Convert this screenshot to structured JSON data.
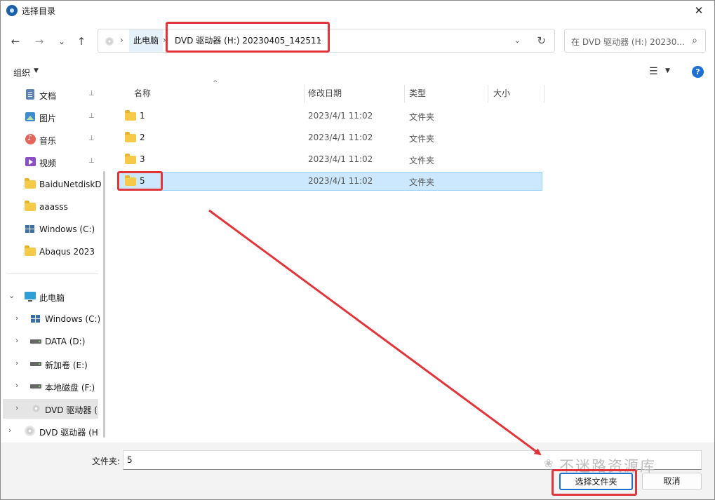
{
  "window": {
    "title": "选择目录",
    "close_glyph": "✕"
  },
  "nav": {
    "back": "←",
    "forward": "→",
    "recent": "⌄",
    "up": "↑"
  },
  "address": {
    "sep1": "›",
    "pc_label": "此电脑",
    "sep2": "›",
    "dvd_label": "DVD 驱动器 (H:) 20230405_142511",
    "sep3": "›",
    "dropdown": "⌄",
    "refresh": "↻"
  },
  "search": {
    "placeholder": "在 DVD 驱动器 (H:) 20230...",
    "icon": "⌕"
  },
  "toolbar": {
    "organize_label": "组织",
    "organize_caret": "▼",
    "view_icon": "☰",
    "view_caret": "▼",
    "help_label": "?"
  },
  "sidebar": {
    "quick_access": [
      {
        "label": "文档",
        "icon": "document-icon",
        "pinned": true
      },
      {
        "label": "图片",
        "icon": "pictures-icon",
        "pinned": true
      },
      {
        "label": "音乐",
        "icon": "music-icon",
        "pinned": true
      },
      {
        "label": "视频",
        "icon": "video-icon",
        "pinned": true
      },
      {
        "label": "BaiduNetdiskD",
        "icon": "folder-icon",
        "pinned": false
      },
      {
        "label": "aaasss",
        "icon": "folder-icon",
        "pinned": false
      },
      {
        "label": "Windows (C:)",
        "icon": "windows-drive-icon",
        "pinned": false
      },
      {
        "label": "Abaqus 2023",
        "icon": "folder-icon",
        "pinned": false
      }
    ],
    "pin_glyph": "📌",
    "this_pc": {
      "label": "此电脑",
      "icon": "computer-icon",
      "expanded_glyph": "⌄"
    },
    "drives": [
      {
        "label": "Windows (C:)",
        "icon": "windows-drive-icon"
      },
      {
        "label": "DATA (D:)",
        "icon": "drive-icon"
      },
      {
        "label": "新加卷 (E:)",
        "icon": "drive-icon"
      },
      {
        "label": "本地磁盘 (F:)",
        "icon": "drive-icon"
      },
      {
        "label": "DVD 驱动器 (",
        "icon": "disc-icon",
        "selected": true
      }
    ],
    "dvd_root": {
      "label": "DVD 驱动器 (H",
      "icon": "disc-icon"
    },
    "collapsed_glyph": "›"
  },
  "columns": {
    "name": "名称",
    "date": "修改日期",
    "type": "类型",
    "size": "大小",
    "sort_glyph": "^"
  },
  "files": [
    {
      "name": "1",
      "date": "2023/4/1 11:02",
      "type": "文件夹",
      "selected": false
    },
    {
      "name": "2",
      "date": "2023/4/1 11:02",
      "type": "文件夹",
      "selected": false
    },
    {
      "name": "3",
      "date": "2023/4/1 11:02",
      "type": "文件夹",
      "selected": false
    },
    {
      "name": "5",
      "date": "2023/4/1 11:02",
      "type": "文件夹",
      "selected": true
    }
  ],
  "footer": {
    "folder_label": "文件夹:",
    "folder_value": "5",
    "select_button": "选择文件夹",
    "cancel_button": "取消"
  },
  "watermark": {
    "text": "不迷路资源库",
    "logo_glyph": "❀"
  },
  "annotations": {
    "color": "#e0353a"
  }
}
